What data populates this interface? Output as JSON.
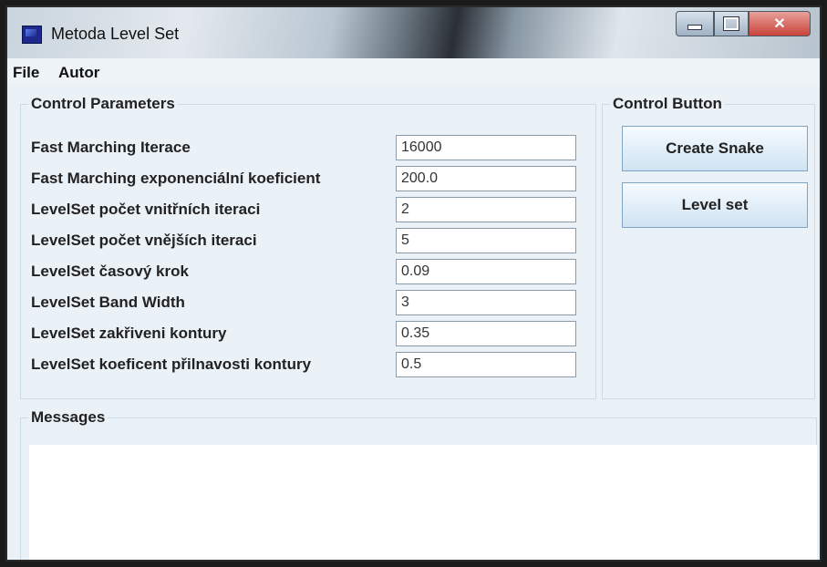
{
  "window": {
    "title": "Metoda Level Set"
  },
  "menu": [
    "File",
    "Autor"
  ],
  "params": {
    "legend": "Control Parameters",
    "rows": [
      {
        "label": "Fast Marching Iterace",
        "value": "16000"
      },
      {
        "label": "Fast Marching exponenciální koeficient",
        "value": "200.0"
      },
      {
        "label": "LevelSet počet vnitřních iteraci",
        "value": "2"
      },
      {
        "label": "LevelSet počet vnějších iteraci",
        "value": "5"
      },
      {
        "label": "LevelSet časový krok",
        "value": "0.09"
      },
      {
        "label": "LevelSet Band Width",
        "value": "3"
      },
      {
        "label": "LevelSet zakřiveni kontury",
        "value": "0.35"
      },
      {
        "label": "LevelSet koeficent přilnavosti kontury",
        "value": "0.5"
      }
    ]
  },
  "controls": {
    "legend": "Control Button",
    "create_snake": "Create Snake",
    "level_set": "Level set"
  },
  "messages": {
    "legend": "Messages",
    "text": ""
  },
  "icons": {
    "app": "app-window-icon",
    "minimize": "minimize-icon",
    "maximize": "maximize-icon",
    "close": "close-icon"
  }
}
